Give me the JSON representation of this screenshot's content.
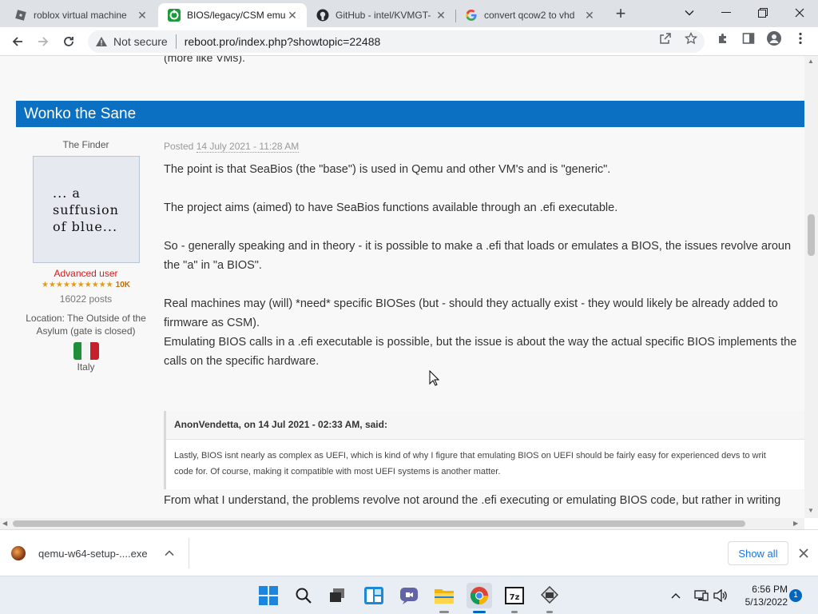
{
  "browser": {
    "tabs": [
      {
        "title": "roblox virtual machine",
        "active": false
      },
      {
        "title": "BIOS/legacy/CSM emu",
        "active": true
      },
      {
        "title": "GitHub - intel/KVMGT-",
        "active": false
      },
      {
        "title": "convert qcow2 to vhd",
        "active": false
      }
    ],
    "security_label": "Not secure",
    "url": "reboot.pro/index.php?showtopic=22488"
  },
  "page": {
    "previous_fragment": "(more like VMs).",
    "author_name": "Wonko the Sane",
    "user": {
      "title": "The Finder",
      "avatar_lines": [
        "... a",
        "suffusion",
        "of blue..."
      ],
      "group": "Advanced user",
      "stars": "★★★★★★★★★★",
      "reputation": "10K",
      "posts": "16022 posts",
      "location_label": "Location: ",
      "location_value": "The Outside of the Asylum (gate is closed)",
      "country": "Italy"
    },
    "post": {
      "posted_label": "Posted",
      "posted_date": "14 July 2021 - 11:28 AM",
      "paragraphs": [
        "The point is that SeaBios (the \"base\") is used in Qemu and other VM's and is \"generic\".",
        "The project aims (aimed) to have SeaBios functions available through an .efi executable.",
        "So - generally speaking and in theory - it is possible to make a .efi that loads or emulates a BIOS, the issues revolve aroun",
        "the \"a\" in \"a BIOS\".",
        "Real machines may (will) *need* specific BIOSes (but - should they actually exist - they would likely be already added to",
        "firmware as CSM).",
        "Emulating BIOS calls in a .efi executable is possible, but the issue is about the way the actual specific BIOS implements the",
        "calls on the specific hardware."
      ],
      "quote": {
        "header": "AnonVendetta, on 14 Jul 2021 - 02:33 AM, said:",
        "lines": [
          "Lastly, BIOS isnt nearly as complex as UEFI, which is kind of why I figure that emulating BIOS on UEFI should be fairly easy for experienced devs to writ",
          "code for. Of course, making it compatible with most UEFI systems is another matter."
        ]
      },
      "after_quote": "From what I understand, the problems revolve not around the .efi executing or emulating BIOS code, but rather in writing"
    }
  },
  "downloads": {
    "file_name": "qemu-w64-setup-....exe",
    "show_all": "Show all"
  },
  "taskbar": {
    "time": "6:56 PM",
    "date": "5/13/2022",
    "notification_count": "1"
  },
  "colors": {
    "author_bar": "#0b6fc2",
    "group": "#d21d1d",
    "link_blue": "#1a73e8"
  }
}
